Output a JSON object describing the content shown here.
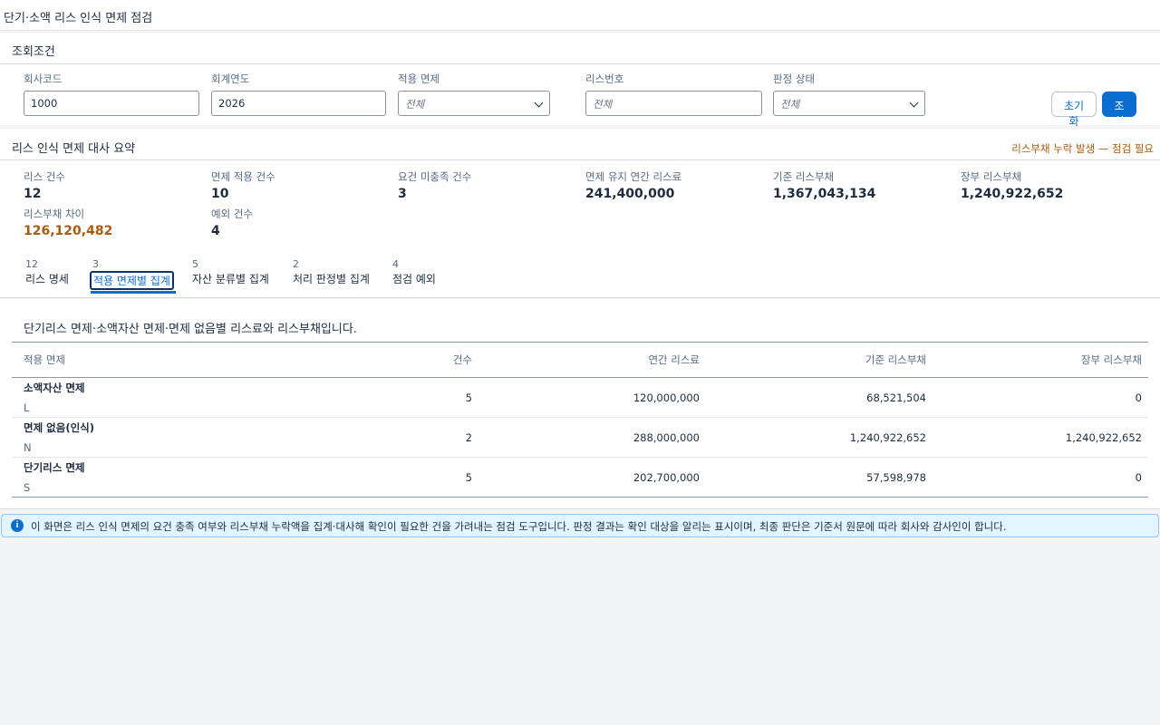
{
  "page_title": "단기·소액 리스 인식 면제 점검",
  "conditions": {
    "title": "조회조건",
    "company_code": {
      "label": "회사코드",
      "value": "1000"
    },
    "fiscal_year": {
      "label": "회계연도",
      "value": "2026"
    },
    "exemption": {
      "label": "적용 면제",
      "value": "전체"
    },
    "lease_no": {
      "label": "리스번호",
      "placeholder": "전체"
    },
    "status": {
      "label": "판정 상태",
      "value": "전체"
    },
    "reset_label": "초기화",
    "search_label": "조회"
  },
  "summary": {
    "title": "리스 인식 면제 대사 요약",
    "warning": "리스부채 누락 발생 — 점검 필요",
    "kpis": [
      {
        "label": "리스 건수",
        "value": "12"
      },
      {
        "label": "면제 적용 건수",
        "value": "10"
      },
      {
        "label": "요건 미충족 건수",
        "value": "3"
      },
      {
        "label": "면제 유지 연간 리스료",
        "value": "241,400,000"
      },
      {
        "label": "기준 리스부채",
        "value": "1,367,043,134"
      },
      {
        "label": "장부 리스부채",
        "value": "1,240,922,652"
      },
      {
        "label": "리스부채 차이",
        "value": "126,120,482"
      },
      {
        "label": "예외 건수",
        "value": "4"
      }
    ]
  },
  "tabs": [
    {
      "count": "12",
      "label": "리스 명세"
    },
    {
      "count": "3",
      "label": "적용 면제별 집계"
    },
    {
      "count": "5",
      "label": "자산 분류별 집계"
    },
    {
      "count": "2",
      "label": "처리 판정별 집계"
    },
    {
      "count": "4",
      "label": "점검 예외"
    }
  ],
  "content": {
    "description": "단기리스 면제·소액자산 면제·면제 없음별 리스료와 리스부채입니다.",
    "columns": [
      "적용 면제",
      "건수",
      "연간 리스료",
      "기준 리스부채",
      "장부 리스부채"
    ],
    "rows": [
      {
        "name": "소액자산 면제",
        "code": "L",
        "count": "5",
        "annual": "120,000,000",
        "base": "68,521,504",
        "book": "0"
      },
      {
        "name": "면제 없음(인식)",
        "code": "N",
        "count": "2",
        "annual": "288,000,000",
        "base": "1,240,922,652",
        "book": "1,240,922,652"
      },
      {
        "name": "단기리스 면제",
        "code": "S",
        "count": "5",
        "annual": "202,700,000",
        "base": "57,598,978",
        "book": "0"
      }
    ]
  },
  "info_text": "이 화면은 리스 인식 면제의 요건 충족 여부와 리스부채 누락액을 집계·대사해 확인이 필요한 건을 가려내는 점검 도구입니다. 판정 결과는 확인 대상을 알리는 표시이며, 최종 판단은 기준서 원문에 따라 회사와 감사인이 합니다."
}
